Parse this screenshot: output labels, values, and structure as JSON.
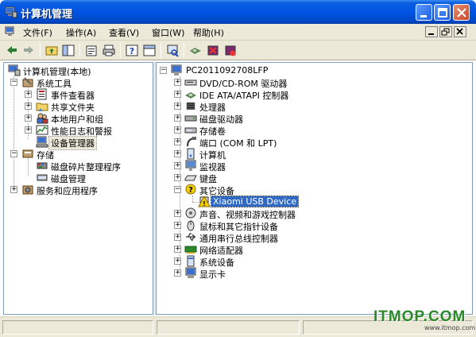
{
  "window": {
    "title": "计算机管理"
  },
  "menu": {
    "items": [
      "文件(F)",
      "操作(A)",
      "查看(V)",
      "窗口(W)",
      "帮助(H)"
    ]
  },
  "left_tree": {
    "root": "计算机管理(本地)",
    "system_tools": "系统工具",
    "event_viewer": "事件查看器",
    "shared_folders": "共享文件夹",
    "local_users": "本地用户和组",
    "perf_logs": "性能日志和警报",
    "device_manager": "设备管理器",
    "storage": "存储",
    "defrag": "磁盘碎片整理程序",
    "disk_mgmt": "磁盘管理",
    "services": "服务和应用程序"
  },
  "right_tree": {
    "computer": "PC2011092708LFP",
    "categories": [
      "DVD/CD-ROM 驱动器",
      "IDE ATA/ATAPI 控制器",
      "处理器",
      "磁盘驱动器",
      "存储卷",
      "端口 (COM 和 LPT)",
      "计算机",
      "监视器",
      "键盘",
      "其它设备",
      "声音、视频和游戏控制器",
      "鼠标和其它指针设备",
      "通用串行总线控制器",
      "网络适配器",
      "系统设备",
      "显示卡"
    ],
    "other_device_child": "Xiaomi USB Device"
  },
  "watermark": {
    "main": "ITMOP.COM",
    "sub": "www.itmop.com"
  },
  "colors": {
    "title_blue": "#0054e3",
    "selection": "#316ac5",
    "chrome": "#ece9d8",
    "warning_yellow": "#f5d000"
  }
}
